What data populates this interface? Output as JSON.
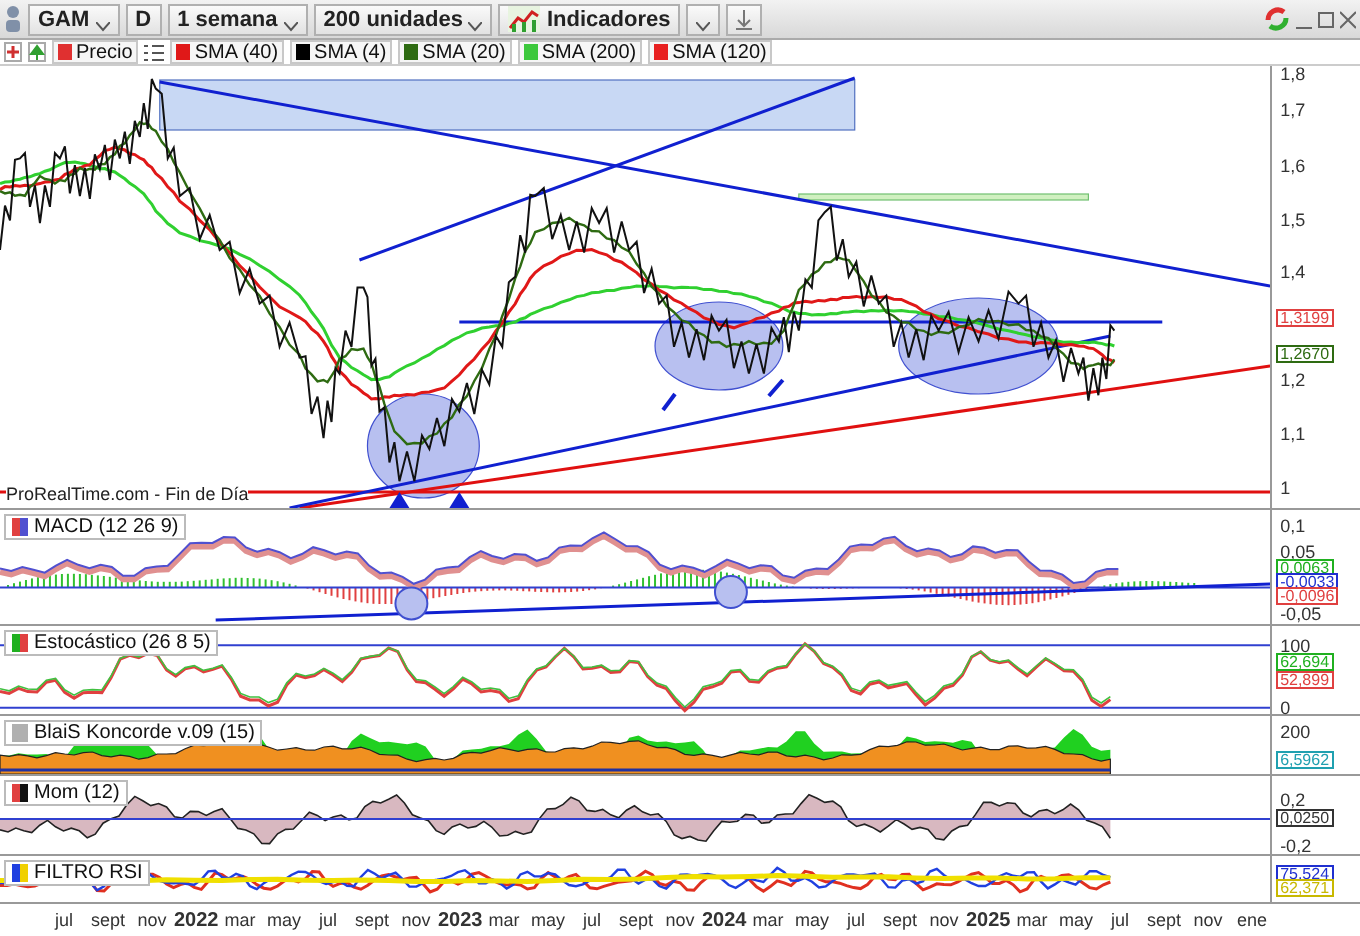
{
  "toolbar": {
    "symbol": "GAM",
    "d_button": "D",
    "period": "1 semana",
    "units": "200 unidades",
    "indicators": "Indicadores"
  },
  "legend": [
    {
      "label": "Precio",
      "color": "#e03030"
    },
    {
      "label": "SMA (40)",
      "color": "#e01818"
    },
    {
      "label": "SMA (4)",
      "color": "#000000"
    },
    {
      "label": "SMA (20)",
      "color": "#2e6b12"
    },
    {
      "label": "SMA (200)",
      "color": "#3cc83c"
    },
    {
      "label": "SMA (120)",
      "color": "#e82020"
    }
  ],
  "price_panel": {
    "source": "ProRealTime.com - Fin de Día",
    "axis_labels": [
      "1,8",
      "1,7",
      "1,6",
      "1,5",
      "1,4",
      "1,2",
      "1,1",
      "1"
    ],
    "value_labels": [
      {
        "text": "1,3199",
        "color": "#e04040"
      },
      {
        "text": "1,2670",
        "color": "#2e6b12"
      }
    ]
  },
  "indicators": [
    {
      "kind": "macd",
      "title": "MACD (12 26 9)",
      "axis_labels": [
        "0,1",
        "0,05",
        "-0,05"
      ],
      "value_labels": [
        {
          "text": "0,0063",
          "color": "#20b020"
        },
        {
          "text": "-0,0033",
          "color": "#2030d0"
        },
        {
          "text": "-0,0096",
          "color": "#e04040"
        }
      ]
    },
    {
      "kind": "stoch",
      "title": "Estocástico (26 8 5)",
      "axis_labels": [
        "100",
        "0"
      ],
      "value_labels": [
        {
          "text": "62,694",
          "color": "#20b020"
        },
        {
          "text": "52,899",
          "color": "#e04040"
        }
      ]
    },
    {
      "kind": "koncorde",
      "title": "BlaiS Koncorde v.09 (15)",
      "axis_labels": [
        "200"
      ],
      "value_labels": [
        {
          "text": "6,5962",
          "color": "#20a0b0"
        }
      ]
    },
    {
      "kind": "mom",
      "title": "Mom (12)",
      "axis_labels": [
        "0,2",
        "-0,2"
      ],
      "value_labels": [
        {
          "text": "0,0250",
          "color": "#333333"
        }
      ]
    },
    {
      "kind": "rsi",
      "title": "FILTRO RSI",
      "value_labels": [
        {
          "text": "75,524",
          "color": "#2030d0"
        },
        {
          "text": "62,371",
          "color": "#c8b800"
        }
      ]
    }
  ],
  "x_axis": [
    {
      "label": "jul",
      "bold": false
    },
    {
      "label": "sept",
      "bold": false
    },
    {
      "label": "nov",
      "bold": false
    },
    {
      "label": "2022",
      "bold": true
    },
    {
      "label": "mar",
      "bold": false
    },
    {
      "label": "may",
      "bold": false
    },
    {
      "label": "jul",
      "bold": false
    },
    {
      "label": "sept",
      "bold": false
    },
    {
      "label": "nov",
      "bold": false
    },
    {
      "label": "2023",
      "bold": true
    },
    {
      "label": "mar",
      "bold": false
    },
    {
      "label": "may",
      "bold": false
    },
    {
      "label": "jul",
      "bold": false
    },
    {
      "label": "sept",
      "bold": false
    },
    {
      "label": "nov",
      "bold": false
    },
    {
      "label": "2024",
      "bold": true
    },
    {
      "label": "mar",
      "bold": false
    },
    {
      "label": "may",
      "bold": false
    },
    {
      "label": "jul",
      "bold": false
    },
    {
      "label": "sept",
      "bold": false
    },
    {
      "label": "nov",
      "bold": false
    },
    {
      "label": "2025",
      "bold": true
    },
    {
      "label": "mar",
      "bold": false
    },
    {
      "label": "may",
      "bold": false
    },
    {
      "label": "jul",
      "bold": false
    },
    {
      "label": "sept",
      "bold": false
    },
    {
      "label": "nov",
      "bold": false
    },
    {
      "label": "ene",
      "bold": false
    }
  ]
}
